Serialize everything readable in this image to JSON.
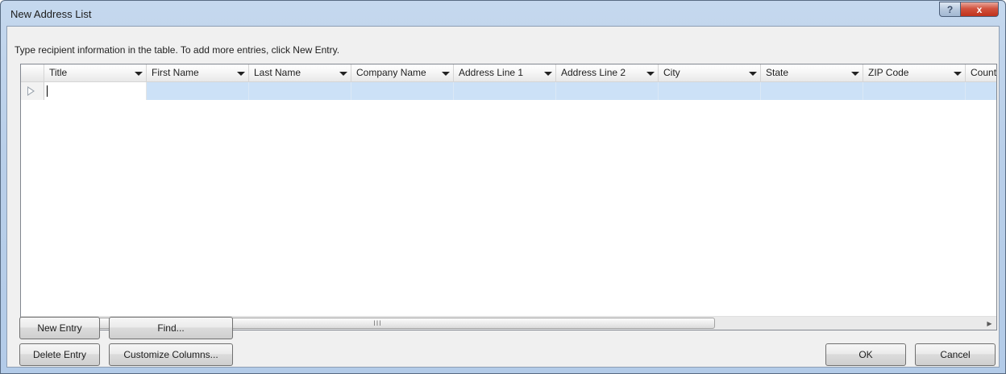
{
  "window": {
    "title": "New Address List",
    "help_glyph": "?",
    "close_glyph": "x"
  },
  "instructions": "Type recipient information in the table.  To add more entries, click New Entry.",
  "table": {
    "columns": [
      "Title",
      "First Name",
      "Last Name",
      "Company Name",
      "Address Line 1",
      "Address Line 2",
      "City",
      "State",
      "ZIP Code",
      "Country or Region"
    ]
  },
  "scrollbar": {
    "left_arrow": "◀",
    "right_arrow": "▶",
    "grip": "III"
  },
  "buttons": {
    "new_entry": "New Entry",
    "find": "Find...",
    "delete_entry": "Delete Entry",
    "customize_columns": "Customize Columns...",
    "ok": "OK",
    "cancel": "Cancel"
  },
  "colors": {
    "selected_row": "#cce1f7",
    "title_bar": "#b9cfe9",
    "close_button": "#c7432e"
  }
}
